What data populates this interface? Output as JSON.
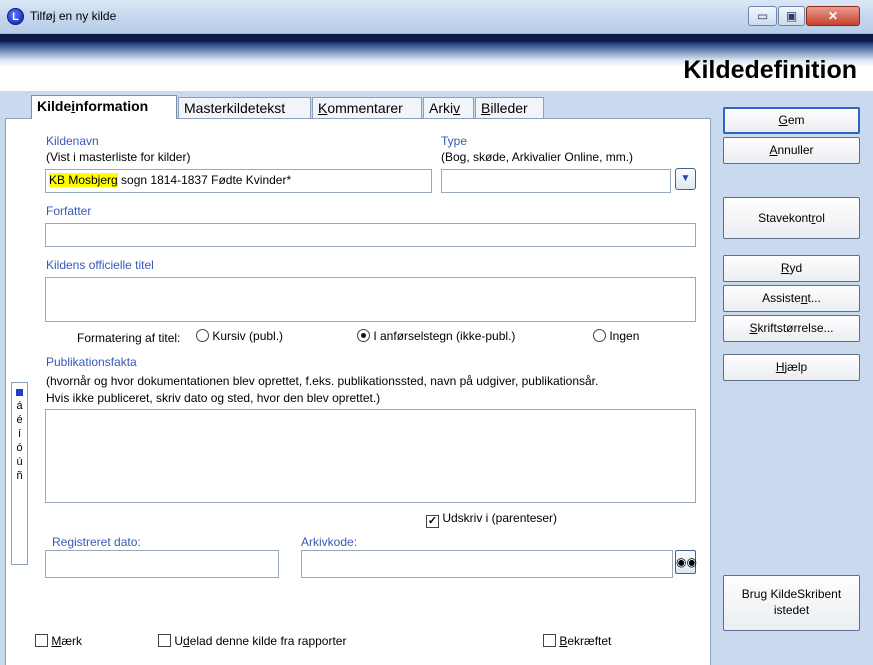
{
  "window": {
    "title": "Tilføj en ny kilde",
    "icon_letter": "L",
    "minimize": "▭",
    "maximize": "▣",
    "close": "✕"
  },
  "header": {
    "title": "Kildedefinition"
  },
  "tabs": [
    {
      "label": "Kildeinformation",
      "active": true
    },
    {
      "label": "Masterkildetekst"
    },
    {
      "label": "Kommentarer"
    },
    {
      "label": "Arkiv"
    },
    {
      "label": "Billeder"
    }
  ],
  "form": {
    "source_name": {
      "label": "Kildenavn",
      "sublabel": "(Vist i masterliste for kilder)",
      "value_highlight": "KB Mosbjerg",
      "value_rest": " sogn 1814-1837 Fødte Kvinder*"
    },
    "type": {
      "label": "Type",
      "sublabel": "(Bog, skøde, Arkivalier Online, mm.)",
      "value": ""
    },
    "author": {
      "label": "Forfatter",
      "value": ""
    },
    "official_title": {
      "label": "Kildens officielle titel",
      "value": ""
    },
    "title_format": {
      "label": "Formatering af titel:",
      "options": [
        "Kursiv (publ.)",
        "I anførselstegn (ikke-publ.)",
        "Ingen"
      ],
      "selected": "I anførselstegn (ikke-publ.)"
    },
    "publication": {
      "label": "Publikationsfakta",
      "help_line1": "(hvornår og hvor dokumentationen blev oprettet, f.eks. publikationssted, navn på udgiver, publikationsår.",
      "help_line2": "Hvis ikke publiceret, skriv dato og sted, hvor den blev oprettet.)",
      "value": ""
    },
    "print_in_parens": {
      "label": "Udskriv i (parenteser)",
      "checked": true
    },
    "registered_date": {
      "label": "Registreret dato:",
      "value": ""
    },
    "archive_code": {
      "label": "Arkivkode:",
      "value": ""
    },
    "mark": {
      "label": "Mærk",
      "checked": false
    },
    "exclude_reports": {
      "label": "Udelad denne kilde fra rapporter",
      "checked": false
    },
    "confirmed": {
      "label": "Bekræftet",
      "checked": false
    }
  },
  "special_chars": [
    "á",
    "é",
    "í",
    "ó",
    "ú",
    "ñ"
  ],
  "buttons": {
    "save": "Gem",
    "cancel": "Annuller",
    "spellcheck": "Stavekontrol",
    "clear": "Ryd",
    "assistant": "Assistent...",
    "font_size": "Skriftstørrelse...",
    "help": "Hjælp",
    "use_writer_1": "Brug KildeSkribent",
    "use_writer_2": "istedet"
  },
  "colors": {
    "label_blue": "#3a58b8",
    "highlight": "#fffd00",
    "header_dark": "#0c1c46",
    "default_button_border": "#2b65c7"
  }
}
